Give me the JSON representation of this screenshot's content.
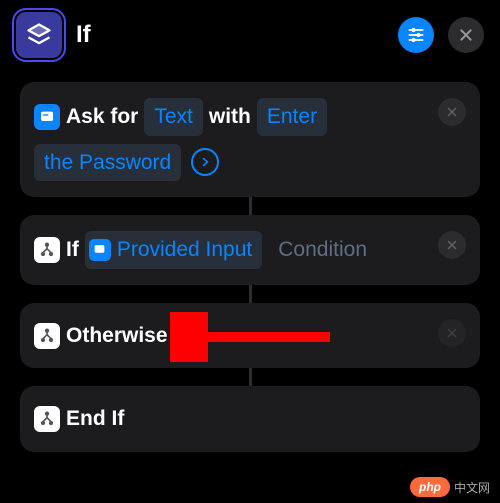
{
  "header": {
    "title": "If"
  },
  "card1": {
    "prefix": "Ask for",
    "type_token": "Text",
    "mid": "with",
    "prompt_token_line1": "Enter",
    "prompt_token_line2": "the Password"
  },
  "card2": {
    "prefix": "If",
    "var_token": "Provided Input",
    "condition_placeholder": "Condition"
  },
  "card3": {
    "label": "Otherwise"
  },
  "card4": {
    "label": "End If"
  },
  "watermark": {
    "brand": "php",
    "site": "中文网"
  }
}
